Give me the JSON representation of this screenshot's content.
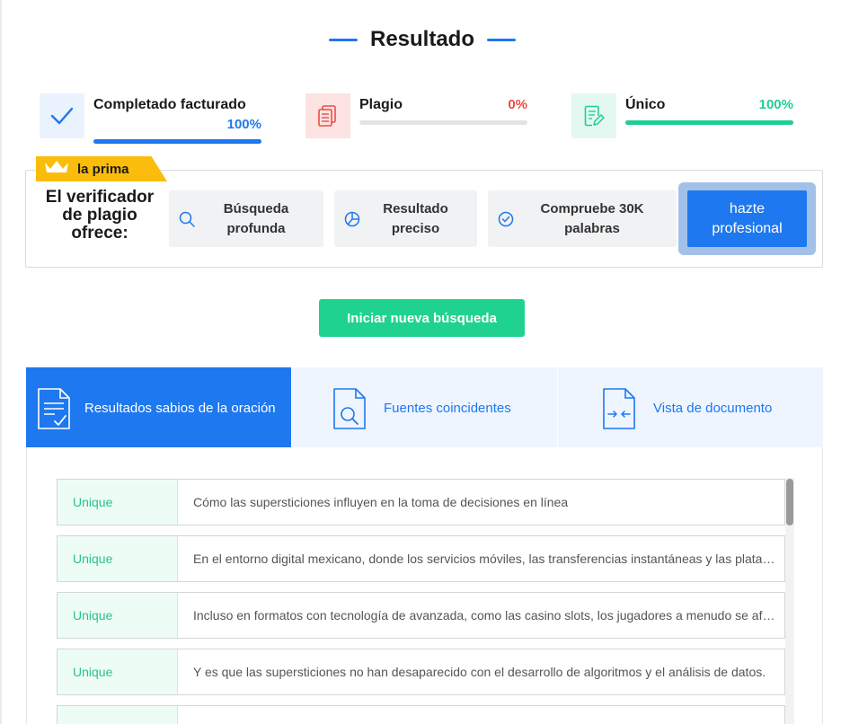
{
  "header": {
    "title": "Resultado"
  },
  "stats": [
    {
      "label": "Completado facturado",
      "percent": "100%",
      "progress": 1.0,
      "color": "#1e78ef",
      "icon": "check-icon"
    },
    {
      "label": "Plagio",
      "percent": "0%",
      "progress": 0.0,
      "color": "#e94e45",
      "icon": "copy-documents-icon"
    },
    {
      "label": "Único",
      "percent": "100%",
      "progress": 1.0,
      "color": "#1fcf8f",
      "icon": "document-edit-icon"
    }
  ],
  "premium": {
    "tag": "la prima",
    "title_lines": [
      "El verificador",
      "de plagio",
      "ofrece:"
    ],
    "features": [
      {
        "lines": [
          "Búsqueda",
          "profunda"
        ],
        "icon": "search-icon"
      },
      {
        "lines": [
          "Resultado",
          "preciso"
        ],
        "icon": "pie-chart-icon"
      },
      {
        "lines": [
          "Compruebe 30K",
          "palabras"
        ],
        "icon": "check-circle-icon"
      }
    ],
    "pro_button_lines": [
      "hazte",
      "profesional"
    ]
  },
  "new_search_label": "Iniciar nueva búsqueda",
  "tabs": [
    {
      "label": "Resultados sabios de la oración",
      "active": true,
      "icon": "document-check-icon"
    },
    {
      "label": "Fuentes coincidentes",
      "active": false,
      "icon": "document-search-icon"
    },
    {
      "label": "Vista de documento",
      "active": false,
      "icon": "document-compare-icon"
    }
  ],
  "results": [
    {
      "status": "Unique",
      "text": "Cómo las supersticiones influyen en la toma de decisiones en línea"
    },
    {
      "status": "Unique",
      "text": "En el entorno digital mexicano, donde los servicios móviles, las transferencias instantáneas y las plataformas"
    },
    {
      "status": "Unique",
      "text": "Incluso en formatos con tecnología de avanzada, como las casino slots, los jugadores a menudo se aferran"
    },
    {
      "status": "Unique",
      "text": "Y es que las supersticiones no han desaparecido con el desarrollo de algoritmos y el análisis de datos."
    }
  ],
  "colors": {
    "accent": "#1e78ef",
    "success": "#1fd28f",
    "danger": "#e94e45",
    "premium": "#fbbd0b"
  }
}
